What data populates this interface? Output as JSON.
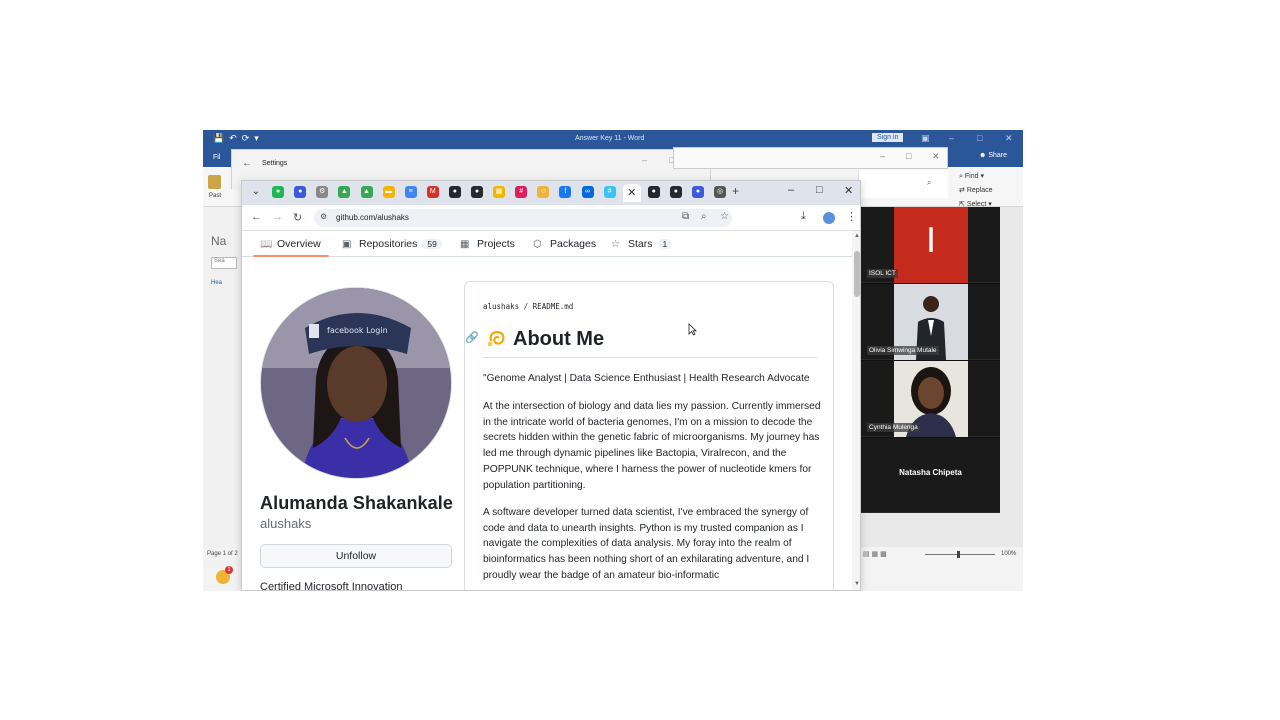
{
  "word": {
    "title": "Answer Key 11  -  Word",
    "sign_in": "Sign in",
    "share": "Share",
    "file_tab": "Fil",
    "paste_label": "Past",
    "ribbon": {
      "find": "Find",
      "replace": "Replace",
      "select": "Select"
    },
    "nav_heading": "Na",
    "search_placeholder": "Sea",
    "headings_tab": "Hea",
    "status_page": "Page 1 of 2",
    "zoom": "100%",
    "taskbar_badge": "1"
  },
  "settings": {
    "title": "Settings"
  },
  "chrome": {
    "url": "github.com/alushaks",
    "tabs": [
      {
        "icon": "chrome-down-icon",
        "color": "#333333"
      },
      {
        "icon": "spotify-icon",
        "color": "#1db954"
      },
      {
        "icon": "messenger-icon",
        "color": "#3b5bdb"
      },
      {
        "icon": "settings-icon",
        "color": "#888888"
      },
      {
        "icon": "drive-icon",
        "color": "#34a853"
      },
      {
        "icon": "drive-icon",
        "color": "#34a853"
      },
      {
        "icon": "slides-icon",
        "color": "#f4b400"
      },
      {
        "icon": "docs-icon",
        "color": "#4285f4"
      },
      {
        "icon": "gmail-icon",
        "color": "#d93025"
      },
      {
        "icon": "github-icon",
        "color": "#24292f"
      },
      {
        "icon": "github-icon",
        "color": "#24292f"
      },
      {
        "icon": "sheets-icon",
        "color": "#f4b400"
      },
      {
        "icon": "slack-icon",
        "color": "#e01e5a"
      },
      {
        "icon": "bot-icon",
        "color": "#f0b33a"
      },
      {
        "icon": "facebook-icon",
        "color": "#1877f2"
      },
      {
        "icon": "meta-icon",
        "color": "#0668e1"
      },
      {
        "icon": "slack-icon",
        "color": "#36c5f0"
      },
      {
        "icon": "close-icon",
        "color": "#333333"
      },
      {
        "icon": "github-icon",
        "color": "#24292f"
      },
      {
        "icon": "github-icon",
        "color": "#24292f"
      },
      {
        "icon": "messenger-icon",
        "color": "#3b5bdb"
      },
      {
        "icon": "chrome-icon",
        "color": "#555555"
      }
    ]
  },
  "github": {
    "tabs": [
      {
        "label": "Overview",
        "icon": "book-icon",
        "count": ""
      },
      {
        "label": "Repositories",
        "icon": "repo-icon",
        "count": "59"
      },
      {
        "label": "Projects",
        "icon": "table-icon",
        "count": ""
      },
      {
        "label": "Packages",
        "icon": "package-icon",
        "count": ""
      },
      {
        "label": "Stars",
        "icon": "star-icon",
        "count": "1"
      }
    ],
    "profile": {
      "name": "Alumanda Shakankale",
      "login": "alushaks",
      "follow_button": "Unfollow",
      "bio_partial": "Certified Microsoft Innovation"
    },
    "readme": {
      "path": "alushaks / README.md",
      "heading": "About Me",
      "tagline": "\"Genome Analyst | Data Science Enthusiast | Health Research Advocate",
      "para1": "At the intersection of biology and data lies my passion. Currently immersed in the intricate world of bacteria genomes, I'm on a mission to decode the secrets hidden within the genetic fabric of microorganisms. My journey has led me through dynamic pipelines like Bactopia, Viralrecon, and the POPPUNK technique, where I harness the power of nucleotide kmers for population partitioning.",
      "para2": "A software developer turned data scientist, I've embraced the synergy of code and data to unearth insights. Python is my trusted companion as I navigate the complexities of data analysis. My foray into the realm of bioinformatics has been nothing short of an exhilarating adventure, and I proudly wear the badge of an amateur bio-informatic"
    }
  },
  "video_call": {
    "participants": [
      {
        "name": "ISOL ICT",
        "tile": "letter",
        "letter": "I",
        "color": "#c42b1c"
      },
      {
        "name": "Olivia Simwinga Mutale",
        "tile": "photo"
      },
      {
        "name": "Cynthia Mulenga",
        "tile": "photo"
      },
      {
        "name": "Natasha Chipeta",
        "tile": "name-only"
      }
    ]
  }
}
